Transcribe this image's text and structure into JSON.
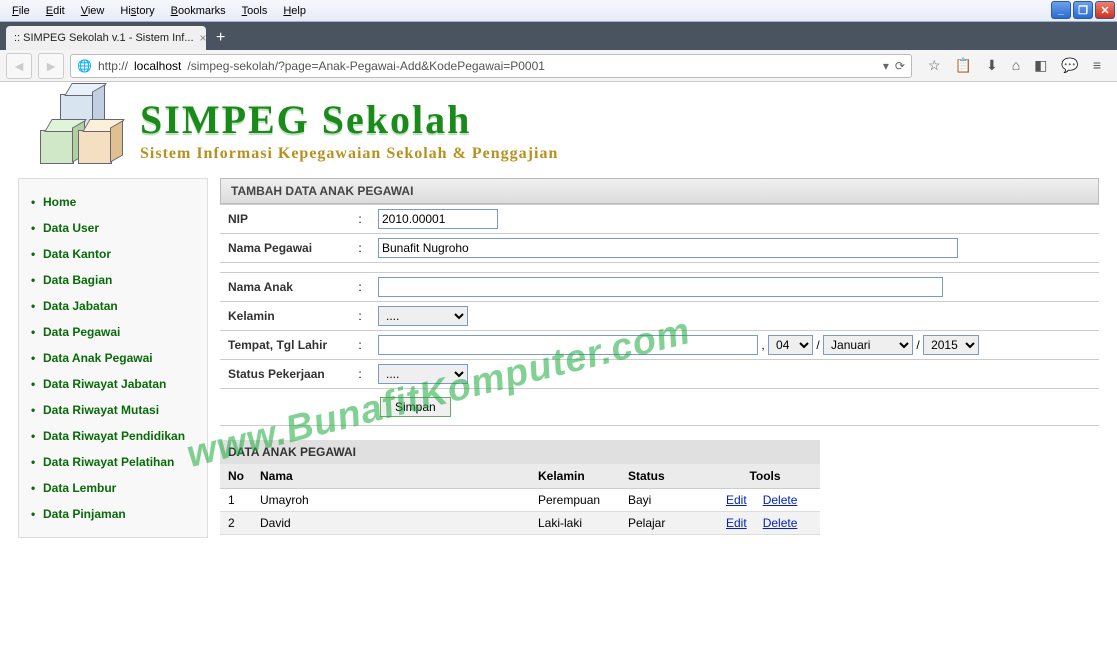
{
  "browser": {
    "menus": [
      "File",
      "Edit",
      "View",
      "History",
      "Bookmarks",
      "Tools",
      "Help"
    ],
    "tab_title": ":: SIMPEG Sekolah v.1 - Sistem Inf...",
    "url_prefix": "http://",
    "url_host": "localhost",
    "url_path": "/simpeg-sekolah/?page=Anak-Pegawai-Add&KodePegawai=P0001"
  },
  "brand": {
    "title": "SIMPEG Sekolah",
    "subtitle": "Sistem Informasi Kepegawaian Sekolah & Penggajian"
  },
  "sidebar": {
    "items": [
      "Home",
      "Data User",
      "Data Kantor",
      "Data Bagian",
      "Data Jabatan",
      "Data Pegawai",
      "Data Anak Pegawai",
      "Data Riwayat Jabatan",
      "Data Riwayat Mutasi",
      "Data Riwayat Pendidikan",
      "Data Riwayat Pelatihan",
      "Data Lembur",
      "Data Pinjaman"
    ]
  },
  "form": {
    "title": "TAMBAH DATA ANAK PEGAWAI",
    "labels": {
      "nip": "NIP",
      "nama_pegawai": "Nama Pegawai",
      "nama_anak": "Nama Anak",
      "kelamin": "Kelamin",
      "ttl": "Tempat, Tgl Lahir",
      "status": "Status Pekerjaan"
    },
    "values": {
      "nip": "2010.00001",
      "nama_pegawai": "Bunafit Nugroho",
      "nama_anak": "",
      "kelamin": "....",
      "tempat": "",
      "day": "04",
      "month": "Januari",
      "year": "2015",
      "status": "....",
      "sep": "/"
    },
    "btn_simpan": "Simpan"
  },
  "data": {
    "title": "DATA ANAK PEGAWAI",
    "headers": {
      "no": "No",
      "nama": "Nama",
      "kelamin": "Kelamin",
      "status": "Status",
      "tools": "Tools"
    },
    "actions": {
      "edit": "Edit",
      "delete": "Delete"
    },
    "rows": [
      {
        "no": "1",
        "nama": "Umayroh",
        "kelamin": "Perempuan",
        "status": "Bayi"
      },
      {
        "no": "2",
        "nama": "David",
        "kelamin": "Laki-laki",
        "status": "Pelajar"
      }
    ]
  },
  "watermark": "www.BunafitKomputer.com"
}
